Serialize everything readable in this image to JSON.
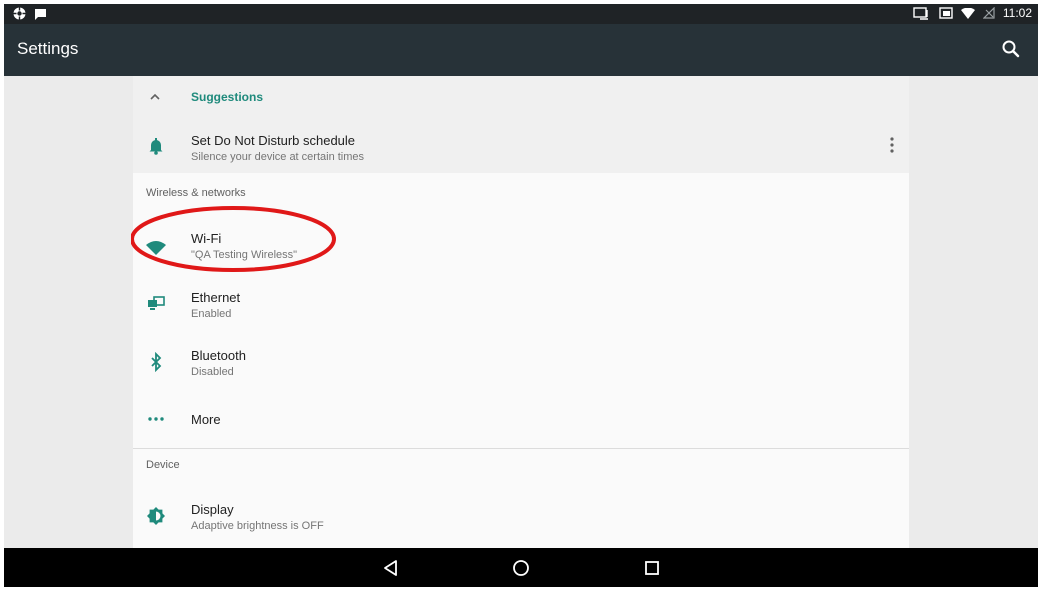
{
  "status_bar": {
    "left_icons": [
      "settings-gear-icon",
      "message-icon"
    ],
    "right_icons": [
      "cast-icon",
      "cast-screen-icon",
      "wifi-signal-icon",
      "no-signal-icon"
    ],
    "time": "11:02"
  },
  "app_bar": {
    "title": "Settings",
    "search_icon": "search-icon"
  },
  "suggestions": {
    "header": "Suggestions",
    "item": {
      "title": "Set Do Not Disturb schedule",
      "subtitle": "Silence your device at certain times",
      "icon": "bell-icon"
    }
  },
  "sections": {
    "wireless": {
      "header": "Wireless & networks",
      "items": [
        {
          "title": "Wi-Fi",
          "subtitle": "\"QA Testing Wireless\"",
          "icon": "wifi-icon"
        },
        {
          "title": "Ethernet",
          "subtitle": "Enabled",
          "icon": "ethernet-icon"
        },
        {
          "title": "Bluetooth",
          "subtitle": "Disabled",
          "icon": "bluetooth-icon"
        },
        {
          "title": "More",
          "subtitle": "",
          "icon": "more-dots-icon"
        }
      ]
    },
    "device": {
      "header": "Device",
      "items": [
        {
          "title": "Display",
          "subtitle": "Adaptive brightness is OFF",
          "icon": "brightness-icon"
        }
      ]
    }
  },
  "navigation_bar": {
    "buttons": [
      "back-icon",
      "home-icon",
      "recents-icon"
    ]
  },
  "colors": {
    "accent": "#1f8a7c",
    "app_bar": "#273238",
    "status_bar": "#1f2326",
    "annotation": "#e01818"
  }
}
